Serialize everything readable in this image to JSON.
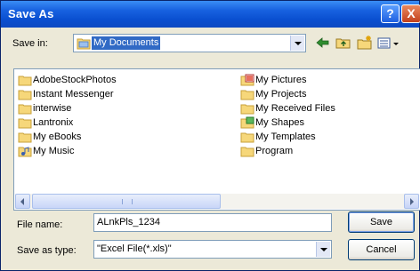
{
  "window": {
    "title": "Save As",
    "help_glyph": "?",
    "close_glyph": "X"
  },
  "save_in": {
    "label": "Save in:",
    "value": "My Documents"
  },
  "toolbar": [
    "back-icon",
    "up-folder-icon",
    "new-folder-icon",
    "views-menu-icon"
  ],
  "files_col1": [
    {
      "name": "AdobeStockPhotos",
      "icon": "folder-icon"
    },
    {
      "name": "Instant Messenger",
      "icon": "folder-icon"
    },
    {
      "name": "interwise",
      "icon": "folder-icon"
    },
    {
      "name": "Lantronix",
      "icon": "folder-icon"
    },
    {
      "name": "My eBooks",
      "icon": "folder-icon"
    },
    {
      "name": "My Music",
      "icon": "music-folder-icon"
    }
  ],
  "files_col2": [
    {
      "name": "My Pictures",
      "icon": "pictures-folder-icon"
    },
    {
      "name": "My Projects",
      "icon": "folder-icon"
    },
    {
      "name": "My Received Files",
      "icon": "folder-icon"
    },
    {
      "name": "My Shapes",
      "icon": "shapes-folder-icon"
    },
    {
      "name": "My Templates",
      "icon": "folder-icon"
    },
    {
      "name": "Program",
      "icon": "folder-icon"
    }
  ],
  "file_name": {
    "label": "File name:",
    "value": "ALnkPls_1234"
  },
  "save_type": {
    "label": "Save as type:",
    "value": "\"Excel File(*.xls)\""
  },
  "buttons": {
    "save": "Save",
    "cancel": "Cancel"
  },
  "colors": {
    "title_bar": "#0a4fd0",
    "selection": "#316ac5",
    "dialog_bg": "#ece9d8"
  }
}
